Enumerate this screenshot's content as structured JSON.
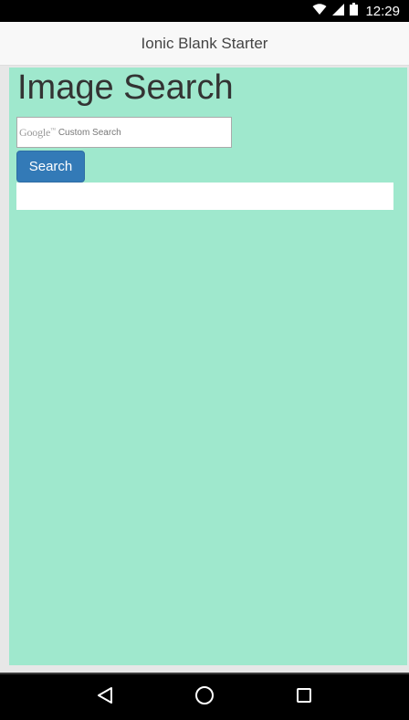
{
  "status_bar": {
    "time": "12:29",
    "icons": [
      "wifi-icon",
      "signal-icon",
      "battery-icon"
    ]
  },
  "header": {
    "title": "Ionic Blank Starter"
  },
  "main": {
    "title": "Image Search",
    "search": {
      "value": "",
      "watermark_brand": "Google",
      "watermark_tm": "™",
      "watermark_label": "Custom Search"
    },
    "search_button_label": "Search"
  },
  "nav_bar": {
    "buttons": [
      "back-icon",
      "home-icon",
      "recents-icon"
    ]
  },
  "colors": {
    "content_bg": "#9fe8cd",
    "button_bg": "#337ab7",
    "header_bg": "#f8f8f8"
  }
}
